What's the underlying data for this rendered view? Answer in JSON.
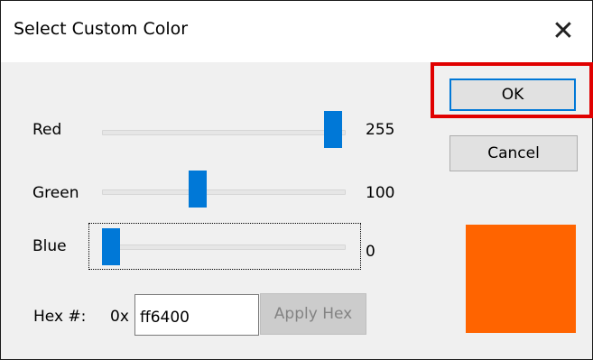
{
  "window": {
    "title": "Select Custom Color",
    "close_glyph": "✕"
  },
  "sliders": [
    {
      "label": "Red",
      "value_text": "255",
      "value": 255,
      "max": 255
    },
    {
      "label": "Green",
      "value_text": "100",
      "value": 100,
      "max": 255
    },
    {
      "label": "Blue",
      "value_text": "0",
      "value": 0,
      "max": 255
    }
  ],
  "buttons": {
    "ok": "OK",
    "cancel": "Cancel",
    "apply_hex": "Apply Hex"
  },
  "hex": {
    "label": "Hex #:",
    "prefix": "0x",
    "value": "ff6400"
  },
  "preview": {
    "color": "#ff6400"
  },
  "colors": {
    "accent": "#0078d7",
    "highlight": "#e00000"
  }
}
